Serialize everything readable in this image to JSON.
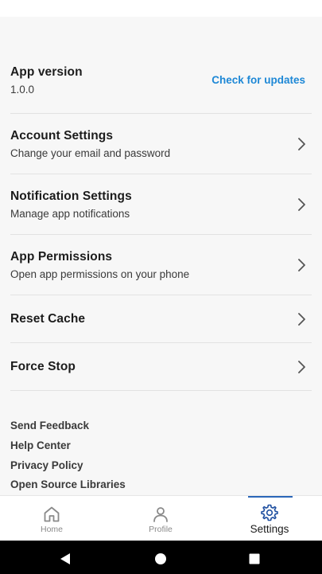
{
  "app_info": {
    "version_label": "App version",
    "version_value": "1.0.0",
    "check_updates": "Check for updates"
  },
  "settings": [
    {
      "title": "Account Settings",
      "subtitle": "Change your email and password"
    },
    {
      "title": "Notification Settings",
      "subtitle": "Manage app notifications"
    },
    {
      "title": "App Permissions",
      "subtitle": "Open app permissions on your phone"
    },
    {
      "title": "Reset Cache"
    },
    {
      "title": "Force Stop"
    }
  ],
  "footer_links": [
    "Send Feedback",
    "Help Center",
    "Privacy Policy",
    "Open Source Libraries"
  ],
  "bottom_nav": [
    {
      "label": "Home",
      "icon": "home-icon"
    },
    {
      "label": "Profile",
      "icon": "person-icon"
    },
    {
      "label": "Settings",
      "icon": "gear-icon",
      "active": true
    }
  ],
  "colors": {
    "accent": "#1e88d6",
    "nav_active": "#2a66b8",
    "nav_inactive": "#8a8a8a"
  }
}
